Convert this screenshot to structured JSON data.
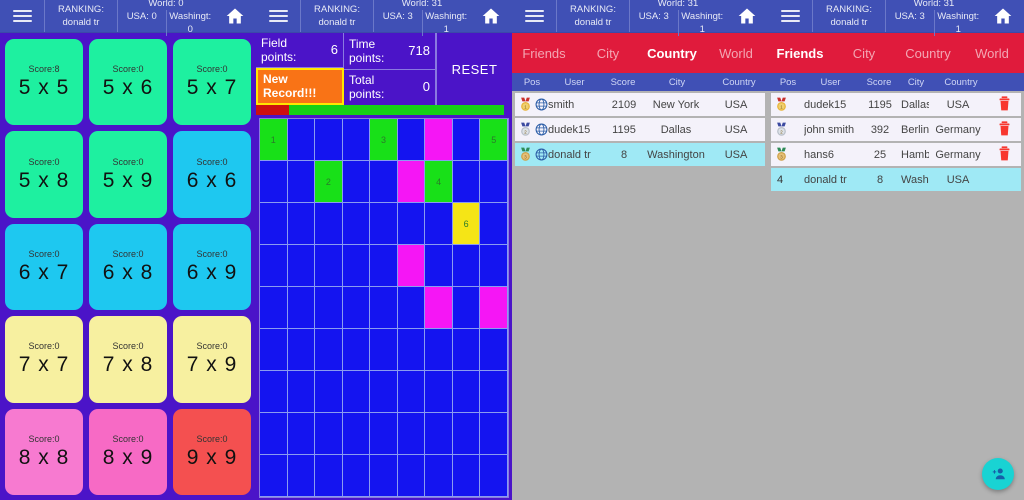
{
  "app": {
    "topbar": {
      "menu_icon": "hamburger-icon",
      "home_icon": "home-icon",
      "ranking_label": "RANKING:",
      "user": "donald tr",
      "panel1": {
        "world": "World: 0",
        "usa": "USA: 0",
        "city": "Washingt: 0"
      },
      "panel2": {
        "world": "World: 31",
        "usa": "USA: 3",
        "city": "Washingt: 1"
      },
      "panel3": {
        "world": "World: 31",
        "usa": "USA: 3",
        "city": "Washingt: 1"
      },
      "panel4": {
        "world": "World: 31",
        "usa": "USA: 3",
        "city": "Washingt: 1"
      }
    }
  },
  "levels": {
    "score_prefix": "Score:",
    "tiles": [
      {
        "score": "Score:8",
        "label": "5 x 5",
        "color": "#1ef0a0"
      },
      {
        "score": "Score:0",
        "label": "5 x 6",
        "color": "#1ef0a0"
      },
      {
        "score": "Score:0",
        "label": "5 x 7",
        "color": "#1ef0a0"
      },
      {
        "score": "Score:0",
        "label": "5 x 8",
        "color": "#1ef0a0"
      },
      {
        "score": "Score:0",
        "label": "5 x 9",
        "color": "#1ef0a0"
      },
      {
        "score": "Score:0",
        "label": "6 x 6",
        "color": "#1ec8f0"
      },
      {
        "score": "Score:0",
        "label": "6 x 7",
        "color": "#1ec8f0"
      },
      {
        "score": "Score:0",
        "label": "6 x 8",
        "color": "#1ec8f0"
      },
      {
        "score": "Score:0",
        "label": "6 x 9",
        "color": "#1ec8f0"
      },
      {
        "score": "Score:0",
        "label": "7 x 7",
        "color": "#f7f0a0"
      },
      {
        "score": "Score:0",
        "label": "7 x 8",
        "color": "#f7f0a0"
      },
      {
        "score": "Score:0",
        "label": "7 x 9",
        "color": "#f7f0a0"
      },
      {
        "score": "Score:0",
        "label": "8 x 8",
        "color": "#f77ad0"
      },
      {
        "score": "Score:0",
        "label": "8 x 9",
        "color": "#f76ac5"
      },
      {
        "score": "Score:0",
        "label": "9 x 9",
        "color": "#f45050"
      }
    ]
  },
  "game": {
    "field_points_label": "Field points:",
    "field_points_value": "6",
    "time_points_label": "Time points:",
    "time_points_value": "718",
    "total_points_label": "Total points:",
    "total_points_value": "0",
    "new_record_label": "New Record!!!",
    "reset_label": "RESET",
    "progress_percent": 97,
    "progress_red_percent": 13,
    "board": {
      "cols": 9,
      "rows": 9,
      "cells": [
        [
          "g1",
          "b",
          "b",
          "b",
          "g3",
          "b",
          "m",
          "b",
          "g5"
        ],
        [
          "b",
          "b",
          "g2",
          "b",
          "b",
          "m",
          "g4",
          "b",
          "b"
        ],
        [
          "b",
          "b",
          "b",
          "b",
          "b",
          "b",
          "b",
          "y6",
          "b"
        ],
        [
          "b",
          "b",
          "b",
          "b",
          "b",
          "m",
          "b",
          "b",
          "b"
        ],
        [
          "b",
          "b",
          "b",
          "b",
          "b",
          "b",
          "m",
          "b",
          "m"
        ],
        [
          "b",
          "b",
          "b",
          "b",
          "b",
          "b",
          "b",
          "b",
          "b"
        ],
        [
          "b",
          "b",
          "b",
          "b",
          "b",
          "b",
          "b",
          "b",
          "b"
        ],
        [
          "b",
          "b",
          "b",
          "b",
          "b",
          "b",
          "b",
          "b",
          "b"
        ],
        [
          "b",
          "b",
          "b",
          "b",
          "b",
          "b",
          "b",
          "b",
          "b"
        ]
      ]
    }
  },
  "ranking_country": {
    "tabs": [
      {
        "label": "Friends",
        "active": false
      },
      {
        "label": "City",
        "active": false
      },
      {
        "label": "Country",
        "active": true
      },
      {
        "label": "World",
        "active": false
      }
    ],
    "headers": [
      "Pos",
      "User",
      "Score",
      "City",
      "Country"
    ],
    "rows": [
      {
        "pos": "1",
        "medal": "gold-medal-icon",
        "icon": "globe-icon",
        "user": "smith",
        "score": "2109",
        "city": "New York",
        "country": "USA",
        "highlight": false
      },
      {
        "pos": "2",
        "medal": "silver-medal-icon",
        "icon": "globe-icon",
        "user": "dudek15",
        "score": "1195",
        "city": "Dallas",
        "country": "USA",
        "highlight": false
      },
      {
        "pos": "3",
        "medal": "bronze-medal-icon",
        "icon": "globe-icon",
        "user": "donald tr",
        "score": "8",
        "city": "Washington",
        "country": "USA",
        "highlight": true
      }
    ]
  },
  "ranking_friends": {
    "tabs": [
      {
        "label": "Friends",
        "active": true
      },
      {
        "label": "City",
        "active": false
      },
      {
        "label": "Country",
        "active": false
      },
      {
        "label": "World",
        "active": false
      }
    ],
    "headers": [
      "Pos",
      "User",
      "Score",
      "City",
      "Country"
    ],
    "rows": [
      {
        "pos": "1",
        "medal": "gold-medal-icon",
        "user": "dudek15",
        "score": "1195",
        "city": "Dallas",
        "country": "USA",
        "highlight": false,
        "delete": true
      },
      {
        "pos": "2",
        "medal": "silver-medal-icon",
        "user": "john smith",
        "score": "392",
        "city": "Berlin",
        "country": "Germany",
        "highlight": false,
        "delete": true
      },
      {
        "pos": "3",
        "medal": "bronze-medal-icon",
        "user": "hans6",
        "score": "25",
        "city": "Hamburg",
        "country": "Germany",
        "highlight": false,
        "delete": true
      },
      {
        "pos": "4",
        "medal": "",
        "user": "donald tr",
        "score": "8",
        "city": "Washington",
        "country": "USA",
        "highlight": true,
        "delete": false
      }
    ],
    "add_friend_icon": "add-person-icon",
    "delete_icon": "trash-icon"
  },
  "colors": {
    "appbar": "#4050b5",
    "tabbar_red": "#e01b3c",
    "background_purple": "#4b14c8",
    "board_blue": "#1414f0",
    "highlight_cyan": "#9fe9f5",
    "fab_teal": "#19d3d3",
    "record_orange": "#f97316"
  }
}
